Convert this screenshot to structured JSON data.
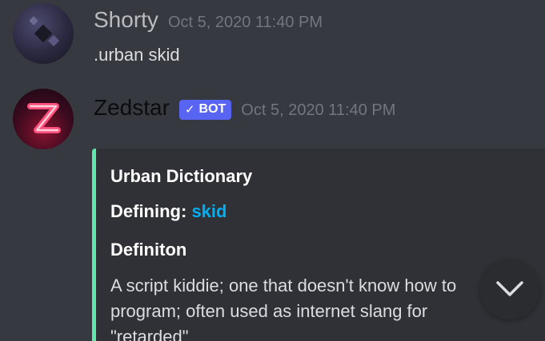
{
  "messages": [
    {
      "username": "Shorty",
      "timestamp": "Oct 5, 2020 11:40 PM",
      "content": ".urban skid",
      "avatar_icon": "user-avatar-dark"
    },
    {
      "username": "Zedstar",
      "timestamp": "Oct 5, 2020 11:40 PM",
      "bot_tag": {
        "check": "✓",
        "label": "BOT",
        "color": "#5865f2"
      },
      "avatar_icon": "zedstar-z-avatar",
      "embed": {
        "accent_color": "#5ee8a9",
        "author": "Urban Dictionary",
        "title_prefix": "Defining: ",
        "title_link": "skid",
        "field_name": "Definiton",
        "field_value": "A script kiddie; one that doesn't know how to program; often used as internet slang for \"retarded\""
      }
    }
  ],
  "scroll_button": {
    "icon": "chevron-down-icon"
  }
}
